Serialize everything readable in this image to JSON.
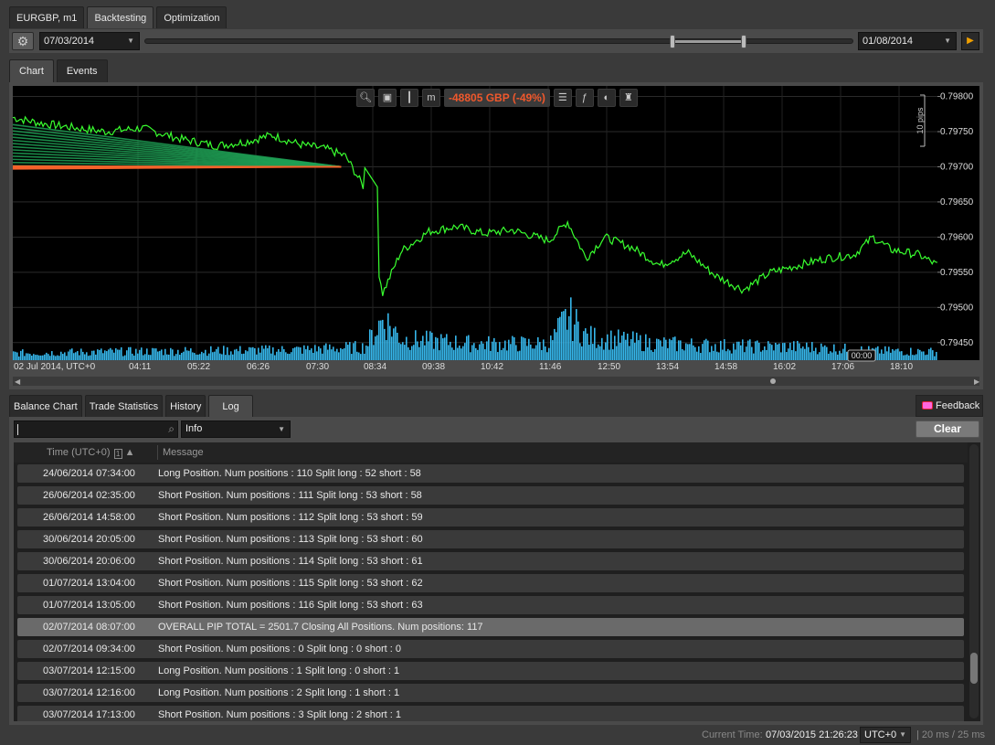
{
  "top_tabs": [
    "EURGBP, m1",
    "Backtesting",
    "Optimization"
  ],
  "toolbar": {
    "start_date": "07/03/2014",
    "end_date": "01/08/2014"
  },
  "chart_tabs": [
    "Chart",
    "Events"
  ],
  "chart_toolbar": {
    "pnl": "-48805 GBP (-49%)"
  },
  "chart_data": {
    "type": "line",
    "symbol": "EURGBP",
    "y_ticks": [
      "0.79800",
      "0.79750",
      "0.79700",
      "0.79650",
      "0.79600",
      "0.79550",
      "0.79500",
      "0.79450"
    ],
    "x_ticks": [
      "02 Jul 2014, UTC+0",
      "04:11",
      "05:22",
      "06:26",
      "07:30",
      "08:34",
      "09:38",
      "10:42",
      "11:46",
      "12:50",
      "13:54",
      "14:58",
      "16:02",
      "17:06",
      "18:10"
    ],
    "ylim": [
      0.79425,
      0.79815
    ],
    "scale_label": "10 pips",
    "crosshair_time": "00:00",
    "grid": true,
    "price_series": [
      {
        "t": 0.0,
        "v": 0.7977
      },
      {
        "t": 0.03,
        "v": 0.79762
      },
      {
        "t": 0.07,
        "v": 0.79755
      },
      {
        "t": 0.1,
        "v": 0.7975
      },
      {
        "t": 0.14,
        "v": 0.79755
      },
      {
        "t": 0.18,
        "v": 0.7974
      },
      {
        "t": 0.22,
        "v": 0.7973
      },
      {
        "t": 0.25,
        "v": 0.79735
      },
      {
        "t": 0.28,
        "v": 0.79745
      },
      {
        "t": 0.31,
        "v": 0.79732
      },
      {
        "t": 0.34,
        "v": 0.79725
      },
      {
        "t": 0.36,
        "v": 0.79715
      },
      {
        "t": 0.38,
        "v": 0.7967
      },
      {
        "t": 0.4,
        "v": 0.7952
      },
      {
        "t": 0.42,
        "v": 0.7958
      },
      {
        "t": 0.45,
        "v": 0.79608
      },
      {
        "t": 0.48,
        "v": 0.79615
      },
      {
        "t": 0.51,
        "v": 0.79605
      },
      {
        "t": 0.54,
        "v": 0.7961
      },
      {
        "t": 0.58,
        "v": 0.79595
      },
      {
        "t": 0.6,
        "v": 0.79622
      },
      {
        "t": 0.62,
        "v": 0.7957
      },
      {
        "t": 0.64,
        "v": 0.796
      },
      {
        "t": 0.67,
        "v": 0.79585
      },
      {
        "t": 0.7,
        "v": 0.7956
      },
      {
        "t": 0.73,
        "v": 0.79578
      },
      {
        "t": 0.76,
        "v": 0.79545
      },
      {
        "t": 0.79,
        "v": 0.79525
      },
      {
        "t": 0.82,
        "v": 0.7955
      },
      {
        "t": 0.85,
        "v": 0.7956
      },
      {
        "t": 0.88,
        "v": 0.7957
      },
      {
        "t": 0.91,
        "v": 0.79575
      },
      {
        "t": 0.93,
        "v": 0.796
      },
      {
        "t": 0.95,
        "v": 0.79582
      },
      {
        "t": 0.98,
        "v": 0.79575
      },
      {
        "t": 1.0,
        "v": 0.7956
      }
    ],
    "volume_series": [
      {
        "t": 0.0,
        "v": 0.15
      },
      {
        "t": 0.1,
        "v": 0.18
      },
      {
        "t": 0.2,
        "v": 0.2
      },
      {
        "t": 0.3,
        "v": 0.22
      },
      {
        "t": 0.38,
        "v": 0.28
      },
      {
        "t": 0.4,
        "v": 0.9
      },
      {
        "t": 0.42,
        "v": 0.45
      },
      {
        "t": 0.5,
        "v": 0.35
      },
      {
        "t": 0.58,
        "v": 0.35
      },
      {
        "t": 0.6,
        "v": 0.95
      },
      {
        "t": 0.62,
        "v": 0.5
      },
      {
        "t": 0.7,
        "v": 0.35
      },
      {
        "t": 0.78,
        "v": 0.3
      },
      {
        "t": 0.86,
        "v": 0.28
      },
      {
        "t": 0.93,
        "v": 0.2
      },
      {
        "t": 1.0,
        "v": 0.18
      }
    ],
    "line_colors": {
      "price": "#39ff2f",
      "volume": "#36b6ea",
      "long_fan": "#1fa055",
      "short_fan": "#f5622a"
    }
  },
  "bottom_tabs": [
    "Balance Chart",
    "Trade Statistics",
    "History",
    "Log"
  ],
  "feedback_label": "Feedback",
  "log": {
    "level": "Info",
    "clear_label": "Clear",
    "col_time": "Time (UTC+0)",
    "sort_index": "1",
    "col_message": "Message",
    "rows": [
      {
        "time": "24/06/2014 07:34:00",
        "msg": "Long Position. Num positions : 110 Split long : 52 short : 58"
      },
      {
        "time": "26/06/2014 02:35:00",
        "msg": "Short Position. Num positions : 111 Split long : 53 short : 58"
      },
      {
        "time": "26/06/2014 14:58:00",
        "msg": "Short Position. Num positions : 112 Split long : 53 short : 59"
      },
      {
        "time": "30/06/2014 20:05:00",
        "msg": "Short Position. Num positions : 113 Split long : 53 short : 60"
      },
      {
        "time": "30/06/2014 20:06:00",
        "msg": "Short Position. Num positions : 114 Split long : 53 short : 61"
      },
      {
        "time": "01/07/2014 13:04:00",
        "msg": "Short Position. Num positions : 115 Split long : 53 short : 62"
      },
      {
        "time": "01/07/2014 13:05:00",
        "msg": "Short Position. Num positions : 116 Split long : 53 short : 63"
      },
      {
        "time": "02/07/2014 08:07:00",
        "msg": "OVERALL PIP TOTAL = 2501.7 Closing All Positions. Num positions: 117"
      },
      {
        "time": "02/07/2014 09:34:00",
        "msg": "Short Position. Num positions : 0 Split long : 0 short : 0"
      },
      {
        "time": "03/07/2014 12:15:00",
        "msg": "Long Position. Num positions : 1 Split long : 0 short : 1"
      },
      {
        "time": "03/07/2014 12:16:00",
        "msg": "Long Position. Num positions : 2 Split long : 1 short : 1"
      },
      {
        "time": "03/07/2014 17:13:00",
        "msg": "Short Position. Num positions : 3 Split long : 2 short : 1"
      }
    ],
    "selected_row": 7
  },
  "status": {
    "label": "Current Time:",
    "time": "07/03/2015 21:26:23",
    "timezone": "UTC+0",
    "perf": "| 20 ms / 25 ms"
  }
}
